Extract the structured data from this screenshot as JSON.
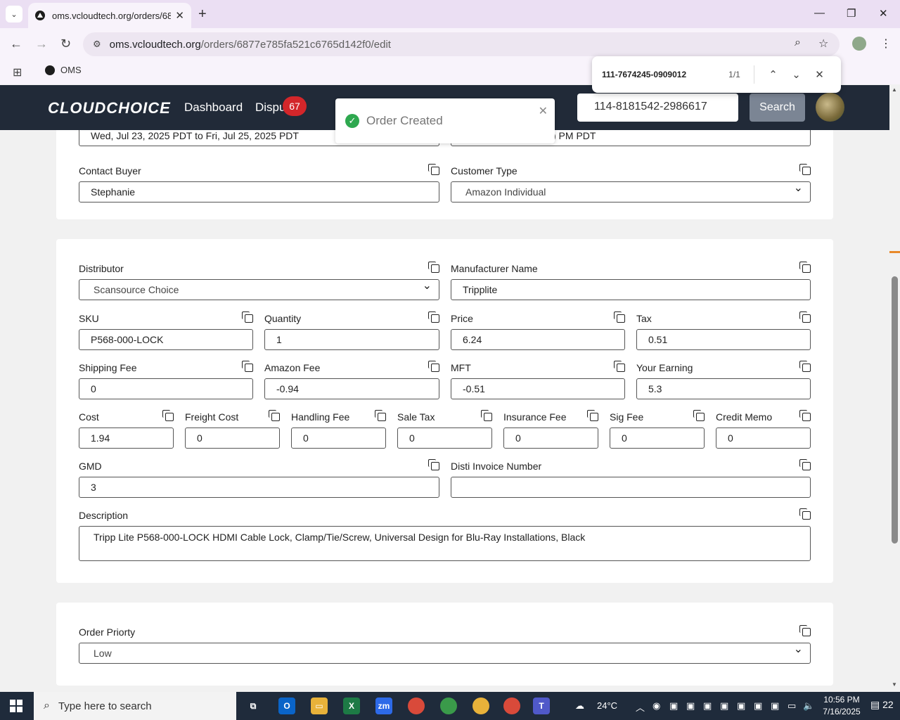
{
  "browser": {
    "tab_title": "oms.vcloudtech.org/orders/687",
    "url_host": "oms.vcloudtech.org",
    "url_path": "/orders/6877e785fa521c6765d142f0/edit",
    "bookmark": "OMS"
  },
  "find_bar": {
    "query": "111-7674245-0909012",
    "count": "1/1"
  },
  "header": {
    "logo": "CLOUDCHOICE",
    "nav": [
      "Dashboard",
      "Dispu"
    ],
    "disputes_badge": "67",
    "search_value": "114-8181542-2986617",
    "search_button": "Search"
  },
  "toast": {
    "message": "Order Created"
  },
  "card1": {
    "date_range_left": "Wed, Jul 23, 2025 PDT to Fri, Jul 25, 2025 PDT",
    "date_range_right": ") PM PDT",
    "contact_buyer": {
      "label": "Contact Buyer",
      "value": "Stephanie"
    },
    "customer_type": {
      "label": "Customer Type",
      "value": "Amazon Individual"
    }
  },
  "card2": {
    "distributor": {
      "label": "Distributor",
      "value": "Scansource Choice"
    },
    "manufacturer": {
      "label": "Manufacturer Name",
      "value": "Tripplite"
    },
    "sku": {
      "label": "SKU",
      "value": "P568-000-LOCK"
    },
    "quantity": {
      "label": "Quantity",
      "value": "1"
    },
    "price": {
      "label": "Price",
      "value": "6.24"
    },
    "tax": {
      "label": "Tax",
      "value": "0.51"
    },
    "shipping_fee": {
      "label": "Shipping Fee",
      "value": "0"
    },
    "amazon_fee": {
      "label": "Amazon Fee",
      "value": "-0.94"
    },
    "mft": {
      "label": "MFT",
      "value": "-0.51"
    },
    "your_earning": {
      "label": "Your Earning",
      "value": "5.3"
    },
    "cost": {
      "label": "Cost",
      "value": "1.94"
    },
    "freight_cost": {
      "label": "Freight Cost",
      "value": "0"
    },
    "handling_fee": {
      "label": "Handling Fee",
      "value": "0"
    },
    "sale_tax": {
      "label": "Sale Tax",
      "value": "0"
    },
    "insurance_fee": {
      "label": "Insurance Fee",
      "value": "0"
    },
    "sig_fee": {
      "label": "Sig Fee",
      "value": "0"
    },
    "credit_memo": {
      "label": "Credit Memo",
      "value": "0"
    },
    "gmd": {
      "label": "GMD",
      "value": "3"
    },
    "disti_invoice": {
      "label": "Disti Invoice Number",
      "value": ""
    },
    "description": {
      "label": "Description",
      "value": "Tripp Lite P568-000-LOCK HDMI Cable Lock, Clamp/Tie/Screw, Universal Design for Blu-Ray Installations, Black"
    }
  },
  "card3": {
    "order_priority": {
      "label": "Order Priorty",
      "value": "Low"
    }
  },
  "taskbar": {
    "search_placeholder": "Type here to search",
    "weather": "24°C",
    "time": "10:56 PM",
    "date": "7/16/2025",
    "notifications": "22"
  },
  "colors": {
    "header_bg": "#212a38",
    "badge": "#d3262a",
    "toast_ok": "#2ea84f",
    "search_button": "#7b8594"
  }
}
